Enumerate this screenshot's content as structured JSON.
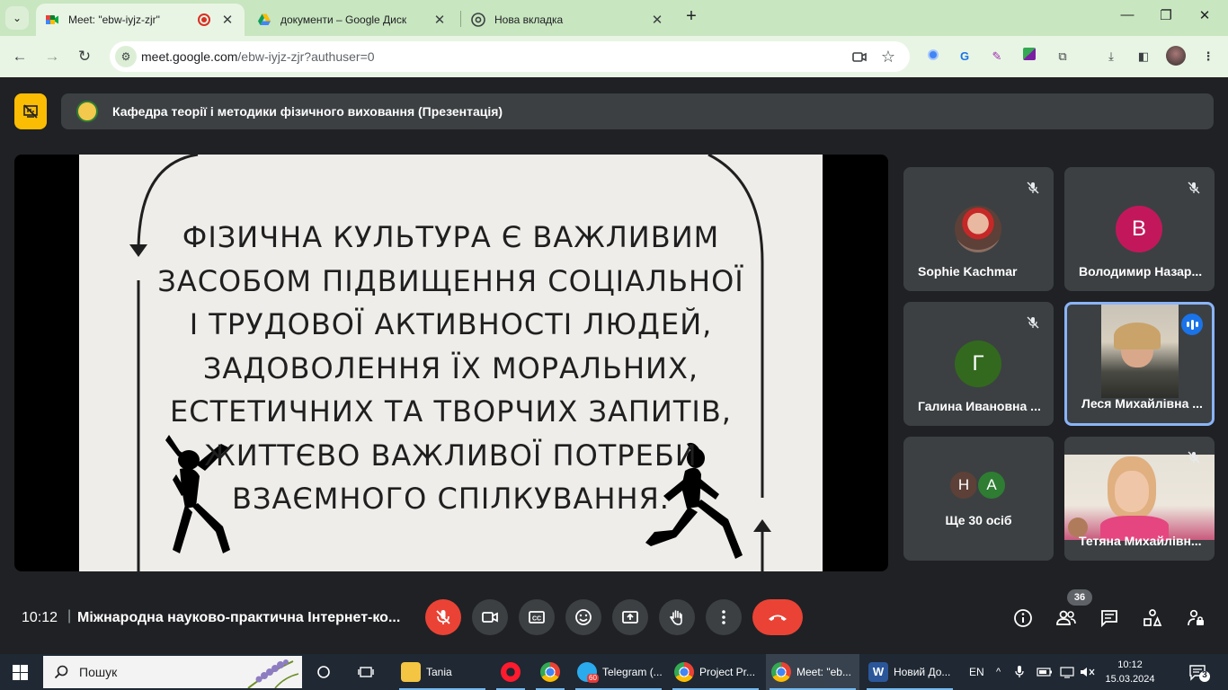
{
  "browser": {
    "tabs": [
      {
        "title": "Meet: \"ebw-iyjz-zjr\"",
        "active": true
      },
      {
        "title": "документи – Google Диск",
        "active": false
      },
      {
        "title": "Нова вкладка",
        "active": false
      }
    ],
    "new_tab": "+",
    "url_host": "meet.google.com",
    "url_path": "/ebw-iyjz-zjr?authuser=0"
  },
  "meet": {
    "presentation_title": "Кафедра теорії і методики фізичного виховання (Презентація)",
    "slide_lines": [
      "ФІЗИЧНА КУЛЬТУРА Є ВАЖЛИВИМ",
      "ЗАСОБОМ ПІДВИЩЕННЯ СОЦІАЛЬНОЇ",
      "І ТРУДОВОЇ АКТИВНОСТІ ЛЮДЕЙ,",
      "ЗАДОВОЛЕННЯ ЇХ МОРАЛЬНИХ,",
      "ЕСТЕТИЧНИХ ТА ТВОРЧИХ ЗАПИТІВ,",
      "ЖИТТЄВО ВАЖЛИВОЇ ПОТРЕБИ",
      "ВЗАЄМНОГО СПІЛКУВАННЯ."
    ],
    "participants": [
      {
        "name": "Sophie Kachmar",
        "muted": true
      },
      {
        "name": "Володимир Назар...",
        "initial": "В",
        "color": "#c2185b",
        "muted": true
      },
      {
        "name": "Галина Ивановна ...",
        "initial": "Г",
        "color": "#33691e",
        "muted": true
      },
      {
        "name": "Леся Михайлівна ...",
        "speaking": true
      },
      {
        "name": "Тетяна Михайлівн...",
        "muted": true
      }
    ],
    "more": {
      "initials": [
        "Н",
        "А"
      ],
      "colors": [
        "#5d4037",
        "#2e7d32"
      ],
      "label": "Ще 30 осіб"
    },
    "time": "10:12",
    "meeting_name": "Міжнародна науково-практична Інтернет-ко...",
    "people_count": "36"
  },
  "taskbar": {
    "search_placeholder": "Пошук",
    "items": [
      "Tania",
      "Telegram (...",
      "Project Pr...",
      "Meet: \"eb...",
      "Новий До..."
    ],
    "telegram_badge": "60",
    "lang": "EN",
    "time": "10:12",
    "date": "15.03.2024",
    "notifications": "3"
  }
}
